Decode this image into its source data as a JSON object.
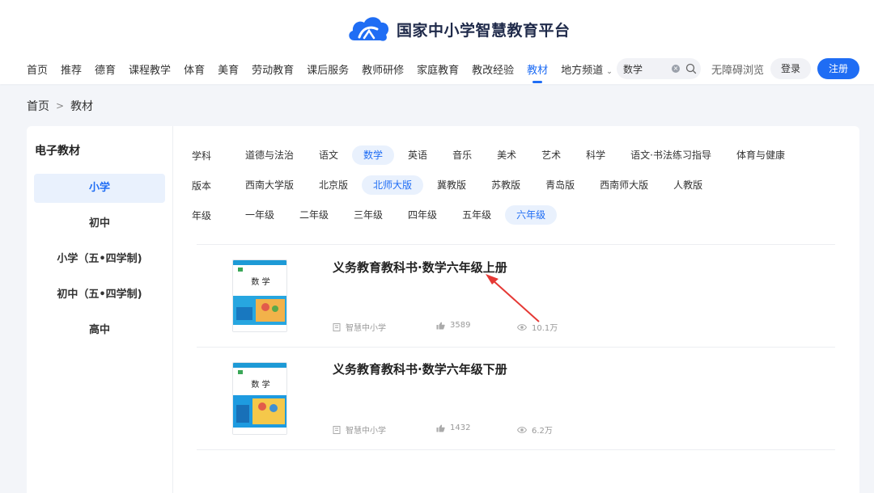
{
  "header": {
    "logo_text": "国家中小学智慧教育平台",
    "nav": [
      "首页",
      "推荐",
      "德育",
      "课程教学",
      "体育",
      "美育",
      "劳动教育",
      "课后服务",
      "教师研修",
      "家庭教育",
      "教改经验",
      "教材",
      "地方频道"
    ],
    "active_nav": "教材",
    "search_value": "数学",
    "accessibility": "无障碍浏览",
    "login": "登录",
    "register": "注册"
  },
  "breadcrumb": {
    "home": "首页",
    "sep": ">",
    "current": "教材"
  },
  "sidebar": {
    "title": "电子教材",
    "items": [
      "小学",
      "初中",
      "小学（五•四学制)",
      "初中（五•四学制)",
      "高中"
    ],
    "active": "小学"
  },
  "filters": {
    "subject": {
      "label": "学科",
      "options": [
        "道德与法治",
        "语文",
        "数学",
        "英语",
        "音乐",
        "美术",
        "艺术",
        "科学",
        "语文·书法练习指导",
        "体育与健康"
      ],
      "active": "数学"
    },
    "edition": {
      "label": "版本",
      "options": [
        "西南大学版",
        "北京版",
        "北师大版",
        "冀教版",
        "苏教版",
        "青岛版",
        "西南师大版",
        "人教版"
      ],
      "active": "北师大版"
    },
    "grade": {
      "label": "年级",
      "options": [
        "一年级",
        "二年级",
        "三年级",
        "四年级",
        "五年级",
        "六年级"
      ],
      "active": "六年级"
    }
  },
  "books": [
    {
      "title": "义务教育教科书·数学六年级上册",
      "source": "智慧中小学",
      "likes": "3589",
      "views": "10.1万",
      "cover_text": "数 学"
    },
    {
      "title": "义务教育教科书·数学六年级下册",
      "source": "智慧中小学",
      "likes": "1432",
      "views": "6.2万",
      "cover_text": "数 学"
    }
  ],
  "colors": {
    "accent": "#1f6df4",
    "annotation_arrow": "#e53935"
  }
}
